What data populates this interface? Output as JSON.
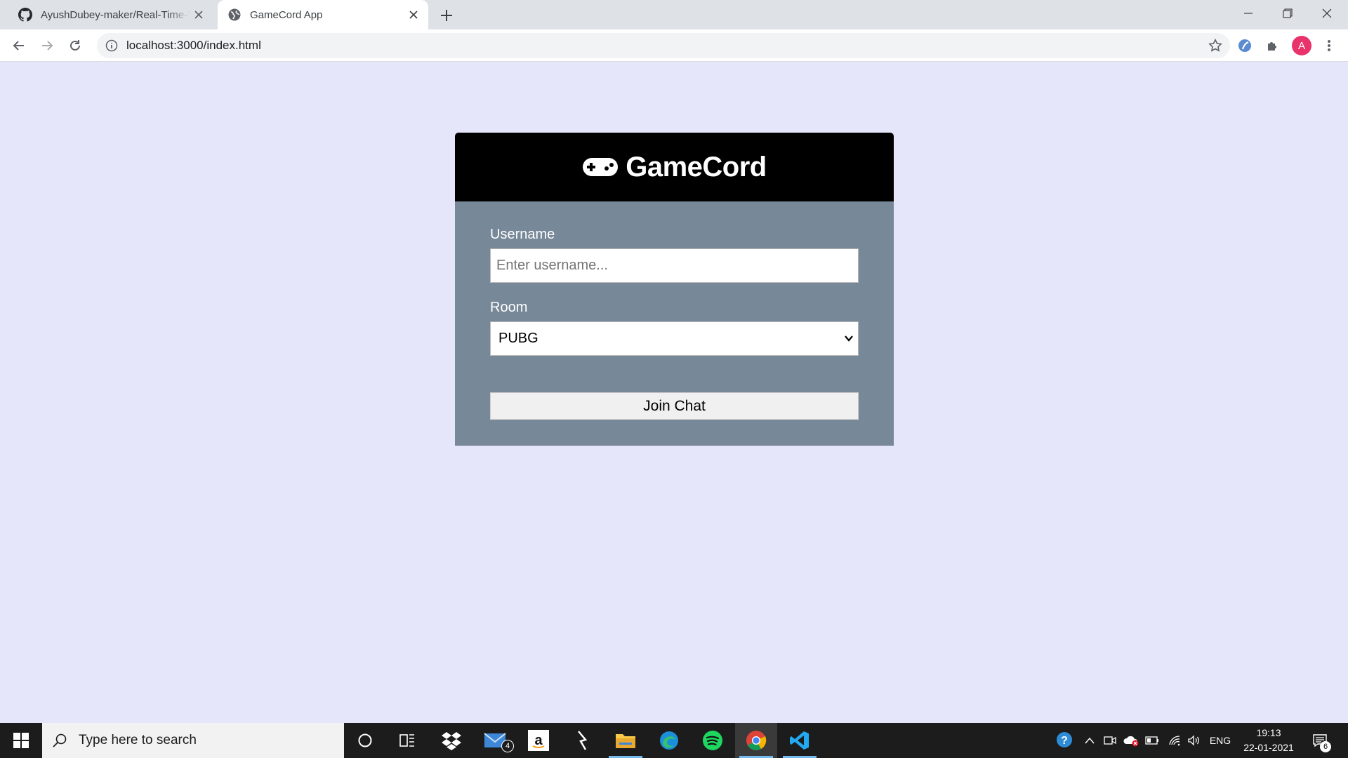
{
  "browser": {
    "tabs": [
      {
        "title": "AyushDubey-maker/Real-Time-W",
        "icon": "github-icon",
        "active": false
      },
      {
        "title": "GameCord App",
        "icon": "globe-icon",
        "active": true
      }
    ],
    "url": "localhost:3000/index.html",
    "profile_initial": "A"
  },
  "app": {
    "brand": "GameCord",
    "username_label": "Username",
    "username_placeholder": "Enter username...",
    "room_label": "Room",
    "room_selected": "PUBG",
    "join_label": "Join Chat",
    "colors": {
      "page_bg": "#e6e6fa",
      "header_bg": "#000000",
      "body_bg": "#778899"
    }
  },
  "taskbar": {
    "search_placeholder": "Type here to search",
    "apps": [
      "cortana",
      "task-view",
      "dropbox",
      "mail",
      "amazon",
      "slash-app",
      "file-explorer",
      "edge",
      "spotify",
      "chrome",
      "vscode"
    ],
    "mail_badge": "4",
    "language": "ENG",
    "time": "19:13",
    "date": "22-01-2021",
    "notification_count": "6"
  }
}
